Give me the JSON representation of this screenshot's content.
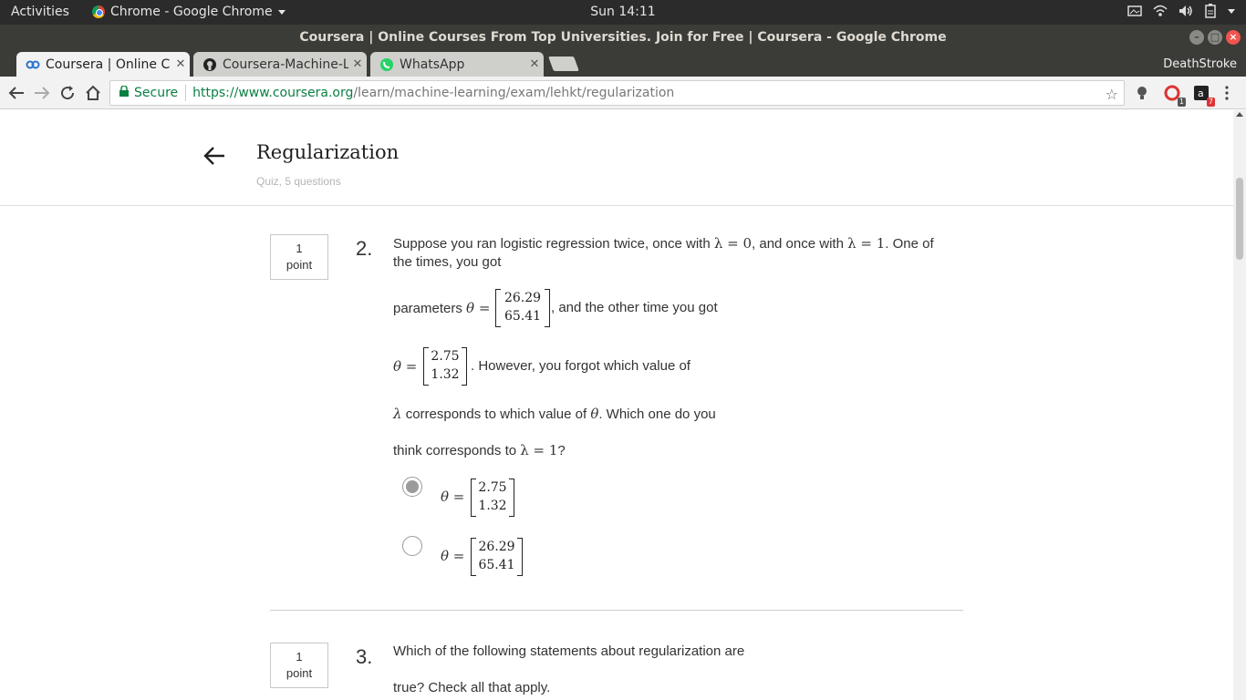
{
  "os": {
    "activities": "Activities",
    "app_name": "Chrome - Google Chrome",
    "clock": "Sun 14:11"
  },
  "window": {
    "title": "Coursera | Online Courses From Top Universities. Join for Free | Coursera - Google Chrome"
  },
  "tabs": [
    {
      "label": "Coursera | Online C",
      "icon": "coursera-icon",
      "active": true
    },
    {
      "label": "Coursera-Machine-L",
      "icon": "github-icon",
      "active": false
    },
    {
      "label": "WhatsApp",
      "icon": "whatsapp-icon",
      "active": false
    }
  ],
  "profile": "DeathStroke",
  "omnibox": {
    "secure_label": "Secure",
    "url_host": "https://www.coursera.org",
    "url_path": "/learn/machine-learning/exam/lehkt/regularization"
  },
  "extensions": [
    {
      "icon": "lightbulb-icon",
      "badge": ""
    },
    {
      "icon": "red-extension-icon",
      "badge": "1"
    },
    {
      "icon": "amazon-icon",
      "badge": "7"
    }
  ],
  "quiz": {
    "back_label": "←",
    "title": "Regularization",
    "subtitle": "Quiz, 5 questions"
  },
  "questions": [
    {
      "number": "2.",
      "points_value": "1",
      "points_unit": "point",
      "line1_a": "Suppose you ran logistic regression twice, once with",
      "line1_b": ", and once with",
      "line1_c": ". One of",
      "lambda0": "λ = 0",
      "lambda1": "λ = 1",
      "line2": "the times, you got",
      "params_prefix": "parameters",
      "theta_eq": "θ =",
      "param1": [
        "26.29",
        "65.41"
      ],
      "params_suffix": ", and the other time you got",
      "param2": [
        "2.75",
        "1.32"
      ],
      "forgot": ". However, you forgot which value of",
      "corr_a": "λ",
      "corr_b": "corresponds to which value of",
      "corr_c": "θ",
      "corr_d": ". Which one do you",
      "think": "think corresponds to",
      "think_end": "?",
      "options": [
        {
          "values": [
            "2.75",
            "1.32"
          ],
          "selected": true
        },
        {
          "values": [
            "26.29",
            "65.41"
          ],
          "selected": false
        }
      ]
    },
    {
      "number": "3.",
      "points_value": "1",
      "points_unit": "point",
      "line1": "Which of the following statements about regularization are",
      "line2": "true? Check all that apply."
    }
  ]
}
